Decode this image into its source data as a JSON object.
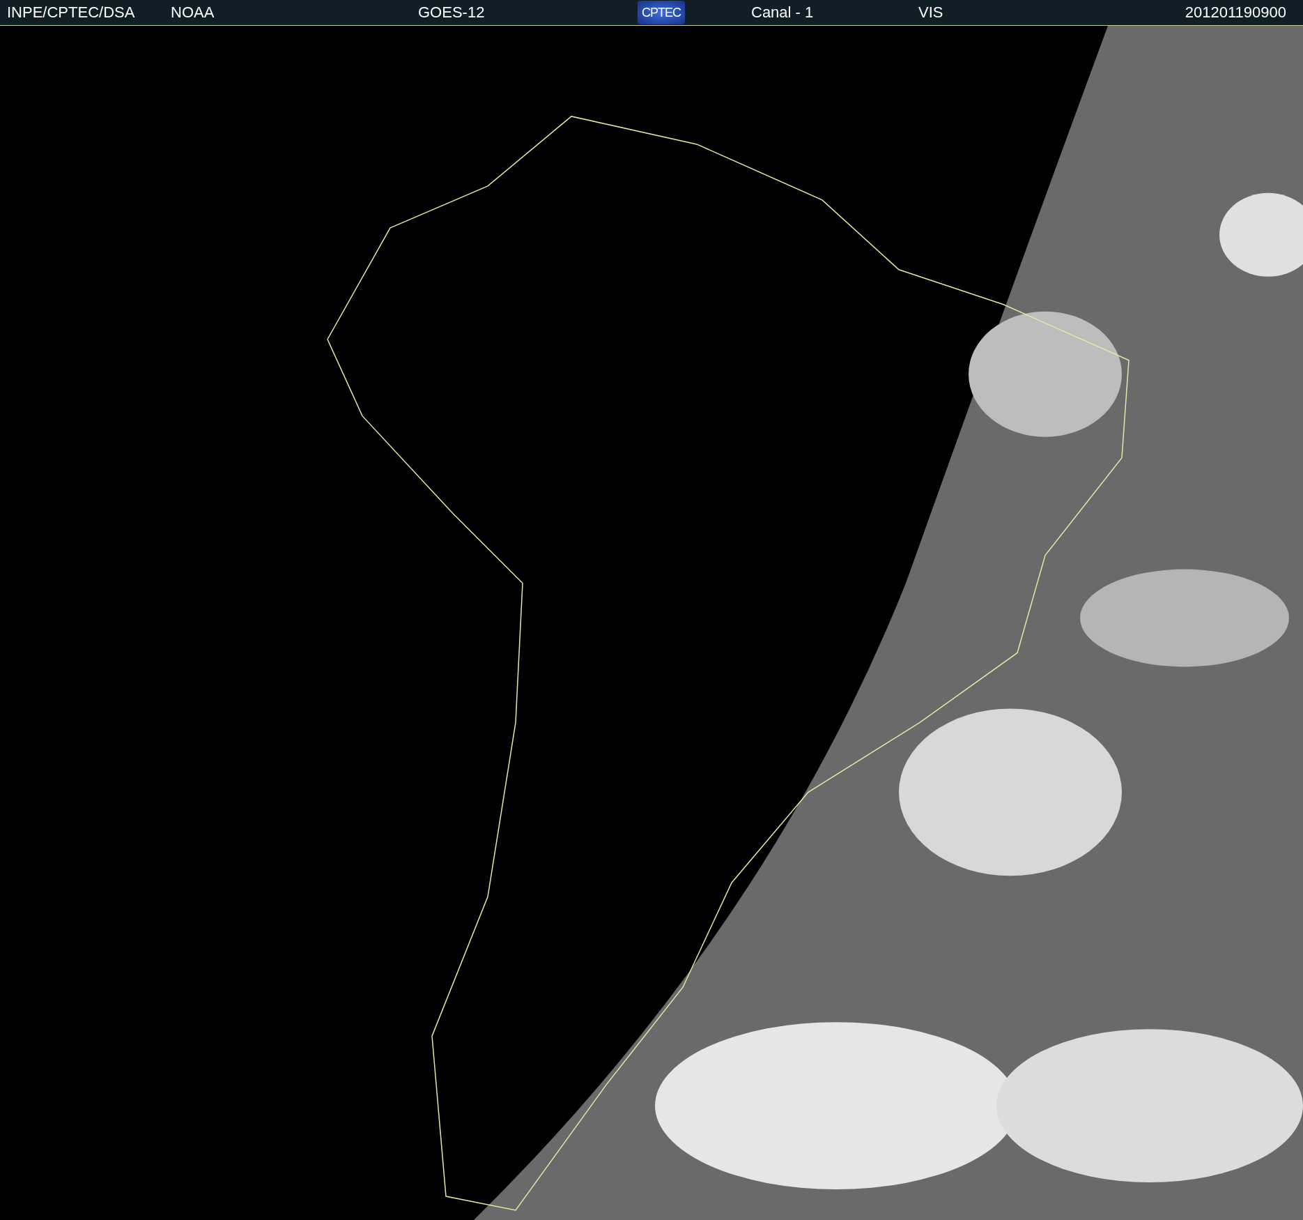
{
  "header": {
    "source": "INPE/CPTEC/DSA",
    "agency": "NOAA",
    "satellite": "GOES-12",
    "logo": "CPTEC",
    "channel": "Canal - 1",
    "band": "VIS",
    "timestamp": "201201190900"
  }
}
